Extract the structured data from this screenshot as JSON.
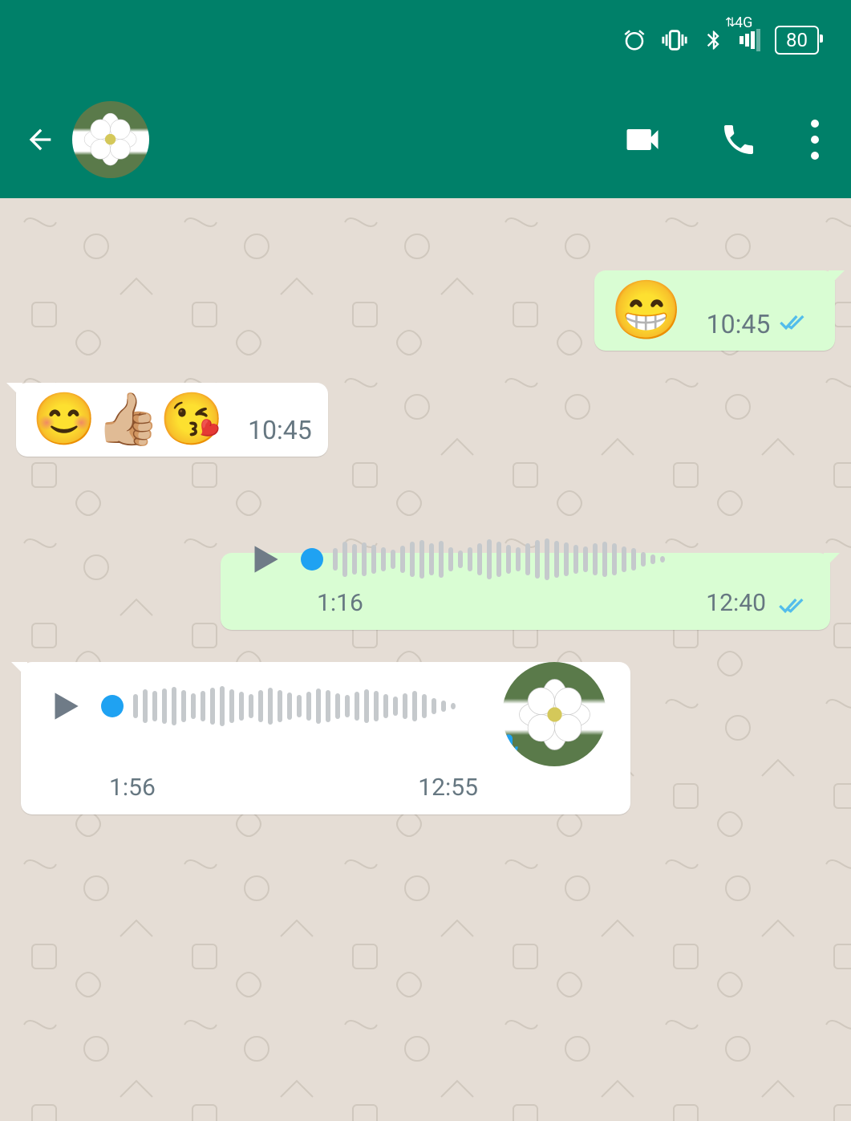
{
  "statusbar": {
    "network": "4G",
    "battery": "80"
  },
  "messages": {
    "msg1": {
      "emoji": "😁",
      "time": "10:45"
    },
    "msg2": {
      "emoji": "😊👍🏼😘",
      "time": "10:45"
    },
    "voice1": {
      "duration": "1:16",
      "time": "12:40"
    },
    "voice2": {
      "duration": "1:56",
      "time": "12:55"
    }
  }
}
